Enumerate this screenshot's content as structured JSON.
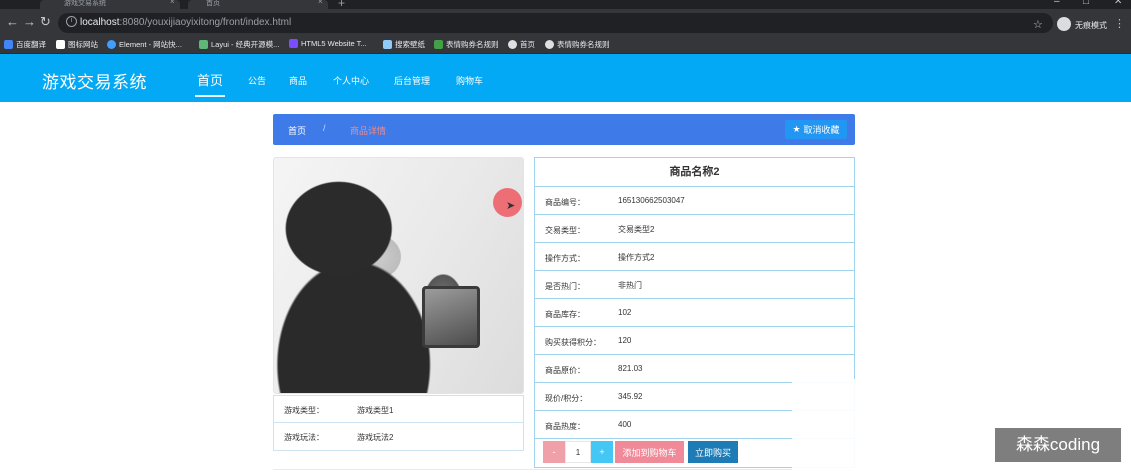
{
  "browser": {
    "tabs": [
      {
        "title": "游戏交易系统"
      },
      {
        "title": "首页"
      }
    ],
    "url_host": "localhost",
    "url_rest": ":8080/youxijiaoyixitong/front/index.html",
    "profile_label": "无痕模式",
    "bookmarks": [
      {
        "label": "百度翻译",
        "icon_color": "#4285f4"
      },
      {
        "label": "图标网站",
        "icon_color": "#ffffff"
      },
      {
        "label": "Element - 网站快...",
        "icon_color": "#409eff"
      },
      {
        "label": "Layui - 经典开源模...",
        "icon_color": "#5fb878"
      },
      {
        "label": "HTML5 Website T...",
        "icon_color": "#7c4dff"
      },
      {
        "label": "搜索壁纸",
        "icon_color": "#90caf9"
      },
      {
        "label": "表情购券名规则",
        "icon_color": "#43a047"
      },
      {
        "label": "首页",
        "icon_color": "#e0e0e0"
      },
      {
        "label": "表情购券名规则",
        "icon_color": "#e0e0e0"
      }
    ]
  },
  "site": {
    "logo": "游戏交易系统",
    "nav": [
      "首页",
      "公告",
      "商品",
      "个人中心",
      "后台管理",
      "购物车"
    ],
    "accent": "#03a9f4"
  },
  "breadcrumb": {
    "home": "首页",
    "separator": "/",
    "current": "商品详情",
    "fav_button": "取消收藏"
  },
  "product_extra": [
    {
      "label": "游戏类型：",
      "value": "游戏类型1"
    },
    {
      "label": "游戏玩法：",
      "value": "游戏玩法2"
    }
  ],
  "product": {
    "title": "商品名称2",
    "fields": [
      {
        "label": "商品编号：",
        "value": "1651306625030​47"
      },
      {
        "label": "交易类型：",
        "value": "交易类型2"
      },
      {
        "label": "操作方式：",
        "value": "操作方式2"
      },
      {
        "label": "是否热门：",
        "value": "非热门"
      },
      {
        "label": "商品库存：",
        "value": "102"
      },
      {
        "label": "购买获得积分：",
        "value": "120"
      },
      {
        "label": "商品原价：",
        "value": "821.03"
      },
      {
        "label": "现价/积分：",
        "value": "345.92"
      },
      {
        "label": "商品热度：",
        "value": "400"
      }
    ],
    "quantity": "1",
    "minus_label": "-",
    "plus_label": "+",
    "add_cart_label": "添加到购物车",
    "buy_now_label": "立即购买"
  },
  "watermark": "森森coding"
}
